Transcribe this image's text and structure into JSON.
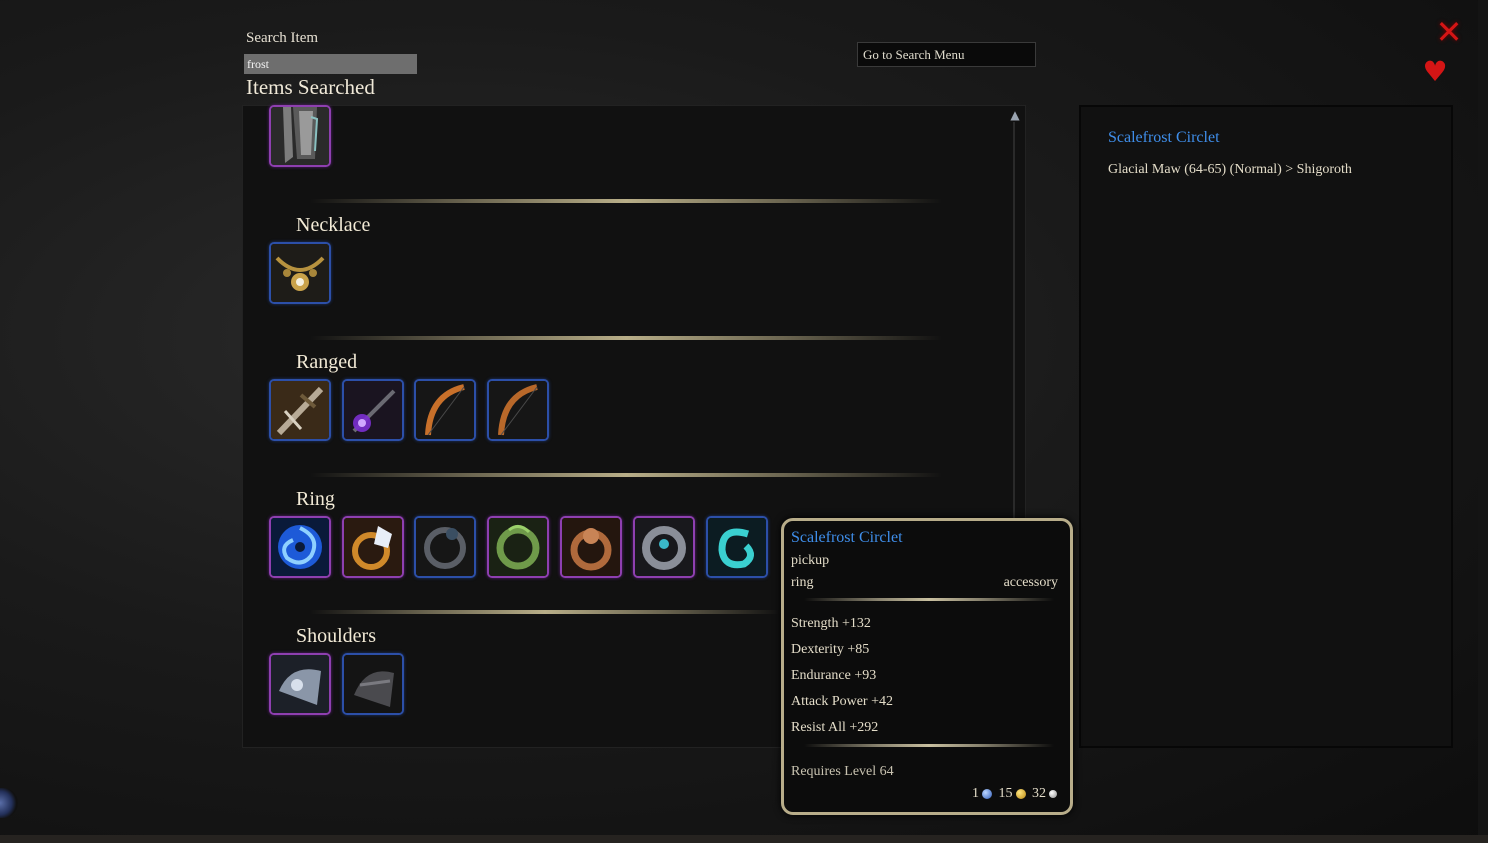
{
  "search": {
    "label": "Search Item",
    "value": "frost",
    "results_title": "Items Searched",
    "goto_button": "Go to Search Menu"
  },
  "window_controls": {
    "close_icon": "close-x-icon",
    "favorite_icon": "heart-icon",
    "accent_red": "#d41515"
  },
  "categories": [
    {
      "name": "",
      "items": [
        {
          "icon": "leg-armor-icon",
          "rarity": "purple"
        }
      ]
    },
    {
      "name": "Necklace",
      "items": [
        {
          "icon": "necklace-icon",
          "rarity": "blue"
        }
      ]
    },
    {
      "name": "Ranged",
      "items": [
        {
          "icon": "crossbow-icon",
          "rarity": "blue"
        },
        {
          "icon": "staff-purple-icon",
          "rarity": "blue"
        },
        {
          "icon": "bow-icon",
          "rarity": "blue"
        },
        {
          "icon": "bow-icon",
          "rarity": "blue"
        }
      ]
    },
    {
      "name": "Ring",
      "items": [
        {
          "icon": "ring-vortex-icon",
          "rarity": "purple"
        },
        {
          "icon": "ring-gem-gold-icon",
          "rarity": "purple"
        },
        {
          "icon": "ring-dark-icon",
          "rarity": "blue"
        },
        {
          "icon": "ring-vine-icon",
          "rarity": "purple"
        },
        {
          "icon": "ring-bronze-icon",
          "rarity": "purple"
        },
        {
          "icon": "ring-steel-icon",
          "rarity": "purple"
        },
        {
          "icon": "ring-cyan-icon",
          "rarity": "blue"
        }
      ]
    },
    {
      "name": "Shoulders",
      "items": [
        {
          "icon": "shoulder-silver-icon",
          "rarity": "purple"
        },
        {
          "icon": "shoulder-dark-icon",
          "rarity": "blue"
        }
      ]
    }
  ],
  "detail": {
    "item_name": "Scalefrost Circlet",
    "location": "Glacial Maw (64-65) (Normal) > Shigoroth"
  },
  "tooltip": {
    "name": "Scalefrost Circlet",
    "bind": "pickup",
    "slot": "ring",
    "type": "accessory",
    "stats": [
      "Strength +132",
      "Dexterity +85",
      "Endurance +93",
      "Attack Power +42",
      "Resist All +292"
    ],
    "requirement": "Requires Level 64",
    "price": {
      "platinum": "1",
      "gold": "15",
      "silver": "32"
    }
  },
  "colors": {
    "item_name_blue": "#3f8eea",
    "rarity_purple": "#8e3fb0",
    "rarity_blue": "#2c4fa8",
    "tooltip_border": "#b8ad8a"
  }
}
